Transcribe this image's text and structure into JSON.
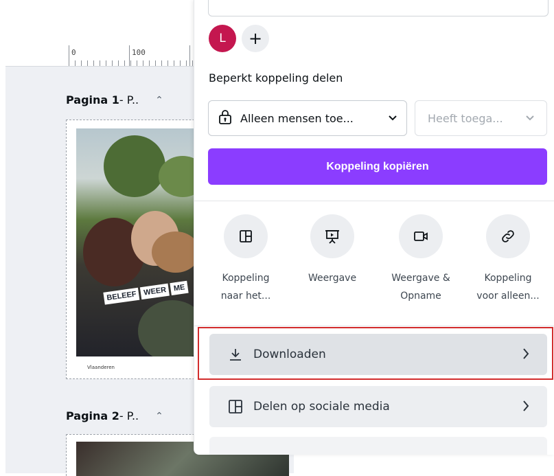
{
  "ruler": {
    "marks": [
      "0",
      "100"
    ]
  },
  "pages": [
    {
      "label_bold": "Pagina 1",
      "label_rest": " - P..",
      "poster_words": [
        "BELEEF",
        "WEER",
        "ME"
      ],
      "logo_text": "Vlaanderen"
    },
    {
      "label_bold": "Pagina 2",
      "label_rest": " - P.."
    }
  ],
  "share": {
    "avatar_letter": "L",
    "add_person": "+",
    "section_title": "Beperkt koppeling delen",
    "access_select": "Alleen mensen toe...",
    "permission_select": "Heeft toega...",
    "copy_button": "Koppeling kopiëren",
    "actions": [
      {
        "line1": "Koppeling",
        "line2": "naar het...",
        "icon": "layout-icon"
      },
      {
        "line1": "Weergave",
        "line2": "",
        "icon": "presentation-icon"
      },
      {
        "line1": "Weergave &",
        "line2": "Opname",
        "icon": "video-camera-icon"
      },
      {
        "line1": "Koppeling",
        "line2": "voor alleen...",
        "icon": "link-icon"
      }
    ],
    "rows": [
      {
        "label": "Downloaden",
        "icon": "download-icon"
      },
      {
        "label": "Delen op sociale media",
        "icon": "social-layout-icon"
      }
    ]
  },
  "colors": {
    "accent": "#8b3dff",
    "avatar": "#c4174f",
    "highlight": "#d22c2c"
  }
}
